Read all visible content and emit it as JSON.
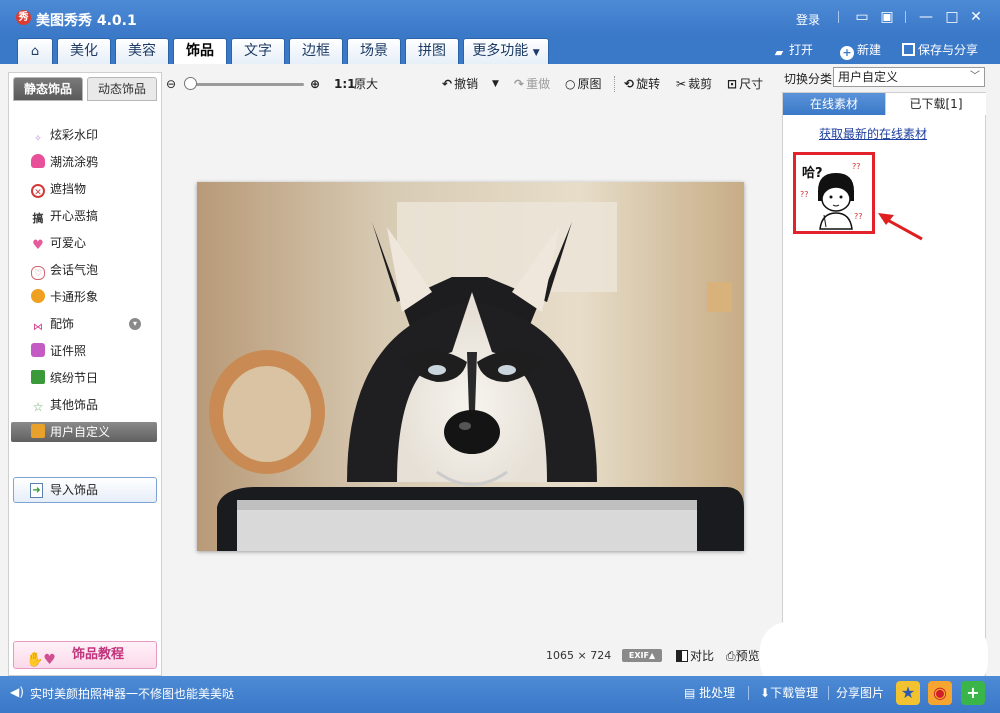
{
  "app": {
    "logo_char": "秀",
    "title": "美图秀秀 4.0.1",
    "login": "登录"
  },
  "window": {
    "icons": [
      "chat-icon",
      "skin-icon",
      "minimize-icon",
      "maximize-icon",
      "close-icon"
    ]
  },
  "tabs": [
    {
      "label": ""
    },
    {
      "label": "美化"
    },
    {
      "label": "美容"
    },
    {
      "label": "饰品"
    },
    {
      "label": "文字"
    },
    {
      "label": "边框"
    },
    {
      "label": "场景"
    },
    {
      "label": "拼图"
    },
    {
      "label": "更多功能"
    }
  ],
  "header_actions": {
    "open": "打开",
    "new": "新建",
    "save_share": "保存与分享"
  },
  "left_panel": {
    "subtabs": [
      "静态饰品",
      "动态饰品"
    ],
    "categories": [
      {
        "label": "炫彩水印",
        "icon": "sparkle-icon",
        "color": "#b77fe0"
      },
      {
        "label": "潮流涂鸦",
        "icon": "lips-icon",
        "color": "#e8519a"
      },
      {
        "label": "遮挡物",
        "icon": "mask-icon",
        "color": "#d23a3a"
      },
      {
        "label": "开心恶搞",
        "icon": "funny-icon",
        "color": "#333333"
      },
      {
        "label": "可爱心",
        "icon": "heart-icon",
        "color": "#e65a9c"
      },
      {
        "label": "会话气泡",
        "icon": "bubble-icon",
        "color": "#d2676f"
      },
      {
        "label": "卡通形象",
        "icon": "cartoon-icon",
        "color": "#f0a020"
      },
      {
        "label": "配饰",
        "icon": "bow-icon",
        "color": "#d23a8a"
      },
      {
        "label": "证件照",
        "icon": "idphoto-icon",
        "color": "#c45ac4"
      },
      {
        "label": "缤纷节日",
        "icon": "gift-icon",
        "color": "#3a9a3a"
      },
      {
        "label": "其他饰品",
        "icon": "star-icon",
        "color": "#5aa05a"
      },
      {
        "label": "用户自定义",
        "icon": "folder-icon",
        "color": "#e8a12a"
      }
    ],
    "import_label": "导入饰品",
    "tutorial_label": "饰品教程"
  },
  "toolbar": {
    "ratio_1to1": "1:1",
    "original_size": "原大",
    "undo": "撤销",
    "redo": "重做",
    "original": "原图",
    "rotate": "旋转",
    "crop": "裁剪",
    "resize": "尺寸"
  },
  "status": {
    "size": "1065 × 724",
    "exif": "EXIF▲",
    "compare": "对比",
    "preview": "预览"
  },
  "right_panel": {
    "switch_label": "切换分类",
    "selected_category": "用户自定义",
    "tabs": [
      "在线素材",
      "已下载[1]"
    ],
    "get_latest": "获取最新的在线素材",
    "sticker_text": "哈?"
  },
  "bottom": {
    "status_text": "实时美颜拍照神器一不修图也能美美哒",
    "batch": "批处理",
    "download_mgr": "下载管理",
    "share": "分享图片"
  }
}
